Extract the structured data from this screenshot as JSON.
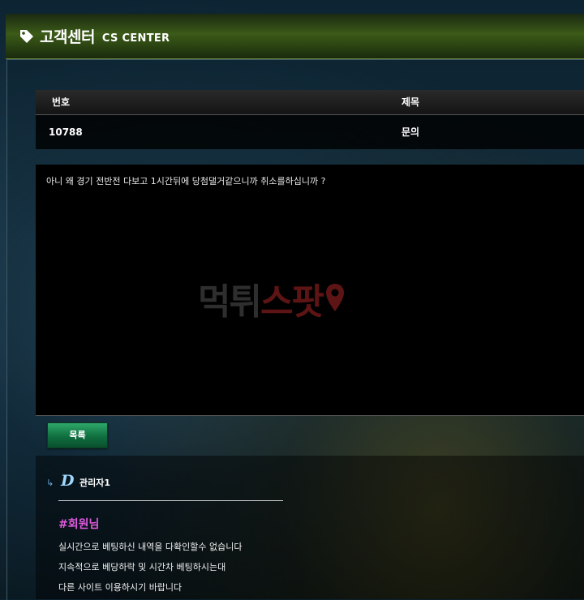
{
  "header": {
    "title_ko": "고객센터",
    "title_en": "CS CENTER",
    "icon": "tag-icon"
  },
  "table": {
    "columns": [
      "번호",
      "제목"
    ],
    "row": {
      "number": "10788",
      "title": "문의"
    }
  },
  "post": {
    "body": "아니 왜 경기 전반전 다보고 1시간뒤에 당첨댈거같으니까  취소를하십니까 ?",
    "watermark": [
      "먹튀",
      "스팟"
    ]
  },
  "buttons": {
    "list_label": "목록"
  },
  "reply": {
    "arrow": "↳",
    "logo": "D",
    "author": "관리자1",
    "greeting": "#회원님",
    "lines": [
      "실시간으로 베팅하신 내역을 다확인할수 없습니다",
      "지속적으로 베당하락 및 시간차 베팅하시는대",
      "다른 사이트 이용하시기 바랍니다"
    ]
  },
  "colors": {
    "header_green": "#3c5a18",
    "button_green": "#0f6e3f",
    "greeting_pink": "#e05be0",
    "watermark_red": "#5c1414"
  }
}
